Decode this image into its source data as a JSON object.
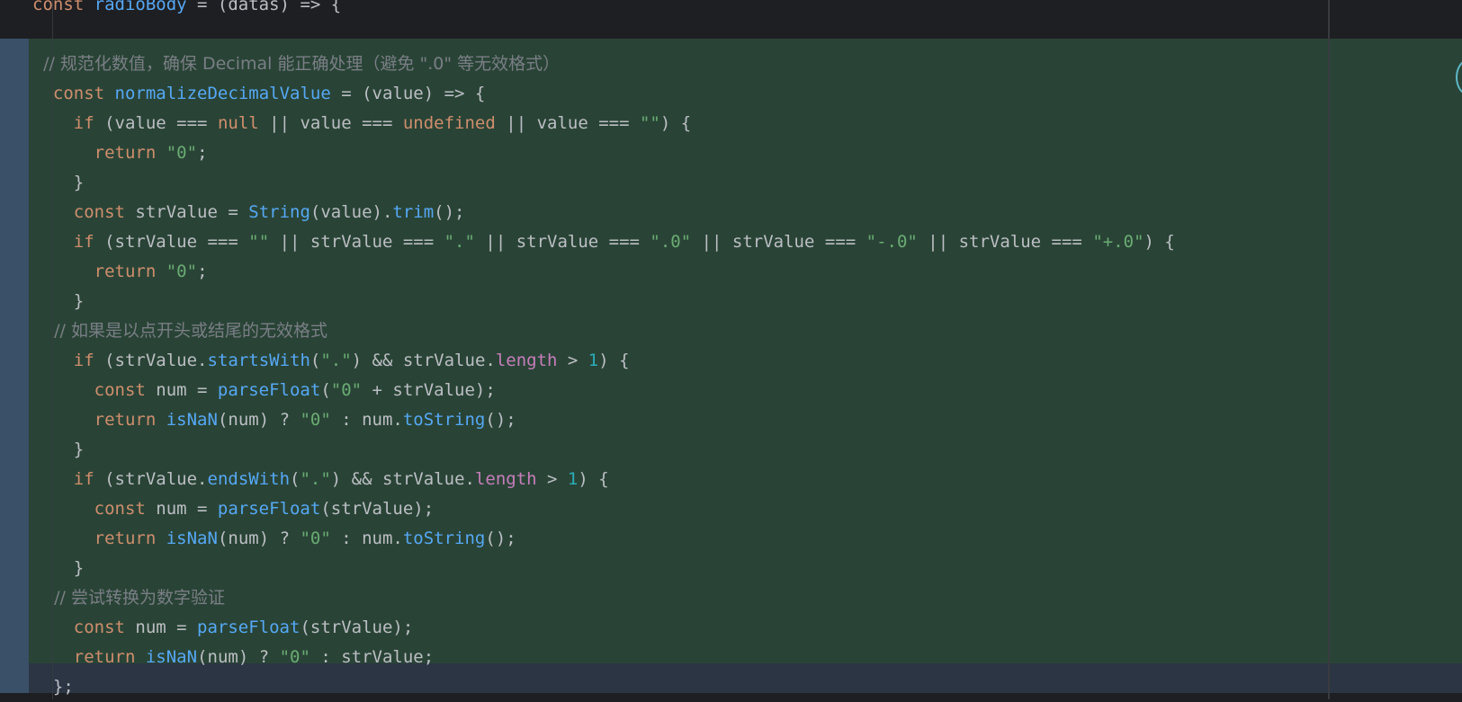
{
  "editor": {
    "lines": [
      [
        {
          "t": "const",
          "c": "kw"
        },
        {
          "t": " "
        },
        {
          "t": "radioBody",
          "c": "fn"
        },
        {
          "t": " = (datas) => {"
        }
      ],
      [],
      [
        {
          "t": "  // 规范化数值，确保 Decimal 能正确处理（避免 \".0\" 等无效格式）",
          "c": "cm"
        }
      ],
      [
        {
          "t": "  "
        },
        {
          "t": "const",
          "c": "kw"
        },
        {
          "t": " "
        },
        {
          "t": "normalizeDecimalValue",
          "c": "fn"
        },
        {
          "t": " = (value) => {"
        }
      ],
      [
        {
          "t": "    "
        },
        {
          "t": "if",
          "c": "kw"
        },
        {
          "t": " (value === "
        },
        {
          "t": "null",
          "c": "kw"
        },
        {
          "t": " || value === "
        },
        {
          "t": "undefined",
          "c": "kw"
        },
        {
          "t": " || value === "
        },
        {
          "t": "\"\"",
          "c": "str"
        },
        {
          "t": ") {"
        }
      ],
      [
        {
          "t": "      "
        },
        {
          "t": "return",
          "c": "kw"
        },
        {
          "t": " "
        },
        {
          "t": "\"0\"",
          "c": "str"
        },
        {
          "t": ";"
        }
      ],
      [
        {
          "t": "    }"
        }
      ],
      [
        {
          "t": "    "
        },
        {
          "t": "const",
          "c": "kw"
        },
        {
          "t": " strValue = "
        },
        {
          "t": "String",
          "c": "fn"
        },
        {
          "t": "(value)."
        },
        {
          "t": "trim",
          "c": "fn"
        },
        {
          "t": "();"
        }
      ],
      [
        {
          "t": "    "
        },
        {
          "t": "if",
          "c": "kw"
        },
        {
          "t": " (strValue === "
        },
        {
          "t": "\"\"",
          "c": "str"
        },
        {
          "t": " || strValue === "
        },
        {
          "t": "\".\"",
          "c": "str"
        },
        {
          "t": " || strValue === "
        },
        {
          "t": "\".0\"",
          "c": "str"
        },
        {
          "t": " || strValue === "
        },
        {
          "t": "\"-.0\"",
          "c": "str"
        },
        {
          "t": " || strValue === "
        },
        {
          "t": "\"+.0\"",
          "c": "str"
        },
        {
          "t": ") {"
        }
      ],
      [
        {
          "t": "      "
        },
        {
          "t": "return",
          "c": "kw"
        },
        {
          "t": " "
        },
        {
          "t": "\"0\"",
          "c": "str"
        },
        {
          "t": ";"
        }
      ],
      [
        {
          "t": "    }"
        }
      ],
      [
        {
          "t": "    // 如果是以点开头或结尾的无效格式",
          "c": "cm"
        }
      ],
      [
        {
          "t": "    "
        },
        {
          "t": "if",
          "c": "kw"
        },
        {
          "t": " (strValue."
        },
        {
          "t": "startsWith",
          "c": "fn"
        },
        {
          "t": "("
        },
        {
          "t": "\".\"",
          "c": "str"
        },
        {
          "t": ") && strValue."
        },
        {
          "t": "length",
          "c": "prop"
        },
        {
          "t": " > "
        },
        {
          "t": "1",
          "c": "num"
        },
        {
          "t": ") {"
        }
      ],
      [
        {
          "t": "      "
        },
        {
          "t": "const",
          "c": "kw"
        },
        {
          "t": " num = "
        },
        {
          "t": "parseFloat",
          "c": "fn"
        },
        {
          "t": "("
        },
        {
          "t": "\"0\"",
          "c": "str"
        },
        {
          "t": " + strValue);"
        }
      ],
      [
        {
          "t": "      "
        },
        {
          "t": "return",
          "c": "kw"
        },
        {
          "t": " "
        },
        {
          "t": "isNaN",
          "c": "fn"
        },
        {
          "t": "(num) ? "
        },
        {
          "t": "\"0\"",
          "c": "str"
        },
        {
          "t": " : num."
        },
        {
          "t": "toString",
          "c": "fn"
        },
        {
          "t": "();"
        }
      ],
      [
        {
          "t": "    }"
        }
      ],
      [
        {
          "t": "    "
        },
        {
          "t": "if",
          "c": "kw"
        },
        {
          "t": " (strValue."
        },
        {
          "t": "endsWith",
          "c": "fn"
        },
        {
          "t": "("
        },
        {
          "t": "\".\"",
          "c": "str"
        },
        {
          "t": ") && strValue."
        },
        {
          "t": "length",
          "c": "prop"
        },
        {
          "t": " > "
        },
        {
          "t": "1",
          "c": "num"
        },
        {
          "t": ") {"
        }
      ],
      [
        {
          "t": "      "
        },
        {
          "t": "const",
          "c": "kw"
        },
        {
          "t": " num = "
        },
        {
          "t": "parseFloat",
          "c": "fn"
        },
        {
          "t": "(strValue);"
        }
      ],
      [
        {
          "t": "      "
        },
        {
          "t": "return",
          "c": "kw"
        },
        {
          "t": " "
        },
        {
          "t": "isNaN",
          "c": "fn"
        },
        {
          "t": "(num) ? "
        },
        {
          "t": "\"0\"",
          "c": "str"
        },
        {
          "t": " : num."
        },
        {
          "t": "toString",
          "c": "fn"
        },
        {
          "t": "();"
        }
      ],
      [
        {
          "t": "    }"
        }
      ],
      [
        {
          "t": "    // 尝试转换为数字验证",
          "c": "cm"
        }
      ],
      [
        {
          "t": "    "
        },
        {
          "t": "const",
          "c": "kw"
        },
        {
          "t": " num = "
        },
        {
          "t": "parseFloat",
          "c": "fn"
        },
        {
          "t": "(strValue);"
        }
      ],
      [
        {
          "t": "    "
        },
        {
          "t": "return",
          "c": "kw"
        },
        {
          "t": " "
        },
        {
          "t": "isNaN",
          "c": "fn"
        },
        {
          "t": "(num) ? "
        },
        {
          "t": "\"0\"",
          "c": "str"
        },
        {
          "t": " : strValue;"
        }
      ],
      [
        {
          "t": "  };"
        }
      ]
    ]
  },
  "colors": {
    "keyword": "#cf8e6d",
    "function": "#56a8f5",
    "string": "#6aab73",
    "number": "#2aacb8",
    "property": "#c77dbb",
    "comment": "#7a7e85",
    "text": "#bcbec4",
    "diff_background": "#294436",
    "diff_gutter": "#3a5068",
    "caret_line_background": "#2b3544"
  }
}
